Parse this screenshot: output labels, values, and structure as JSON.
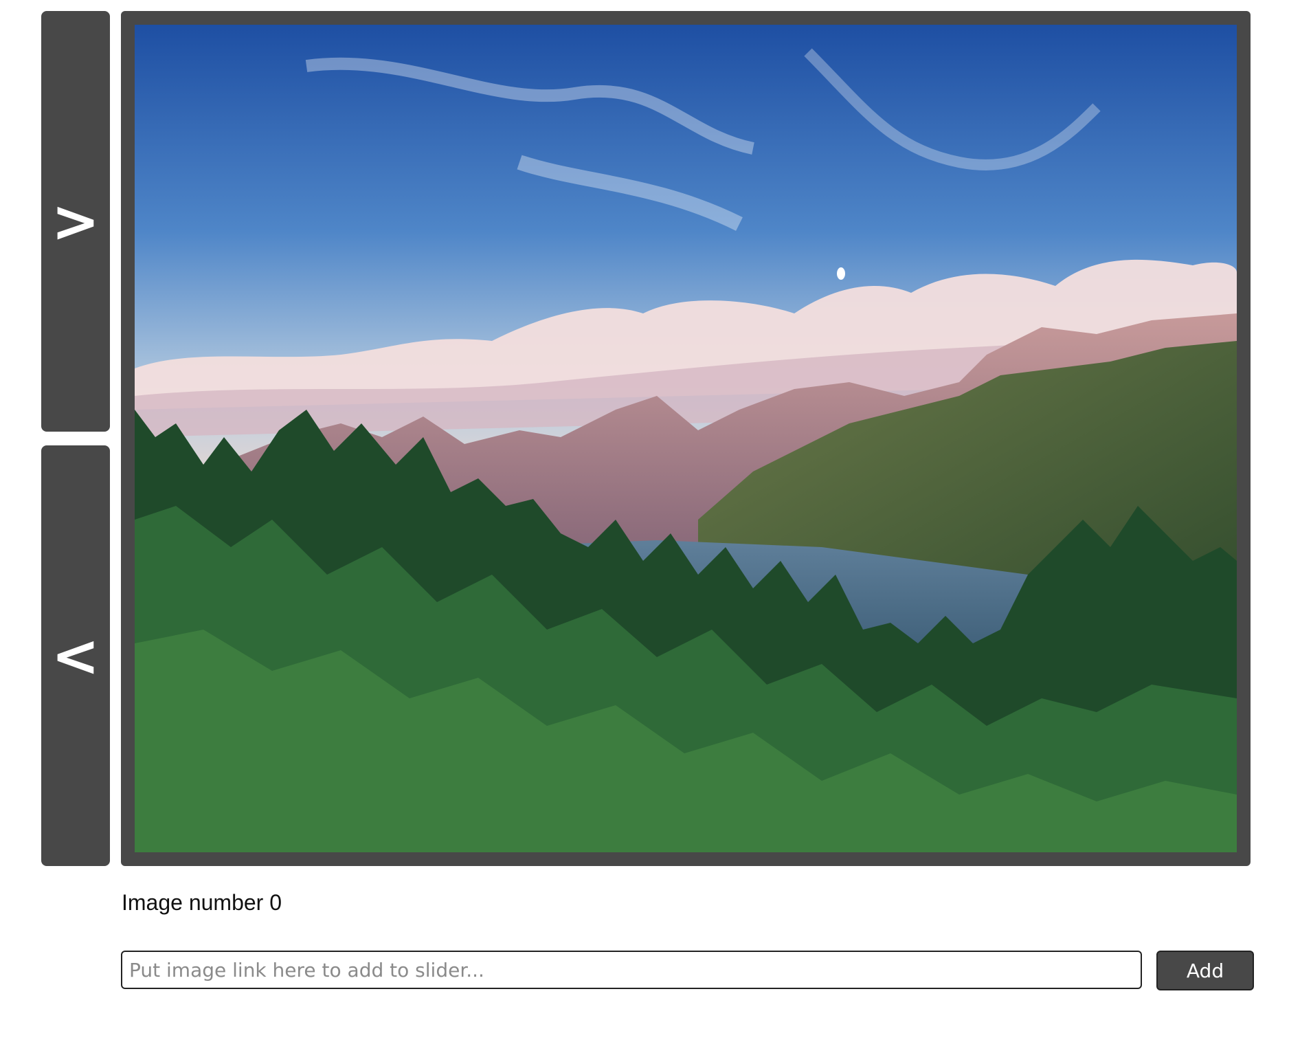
{
  "slider": {
    "next_label": ">",
    "prev_label": "<",
    "current_image_alt": "Mountain lake landscape with forest in foreground"
  },
  "caption": {
    "text": "Image number 0"
  },
  "add_form": {
    "placeholder": "Put image link here to add to slider...",
    "value": "",
    "button_label": "Add"
  },
  "colors": {
    "panel": "#484848",
    "button_text": "#ffffff",
    "input_border": "#222222"
  }
}
